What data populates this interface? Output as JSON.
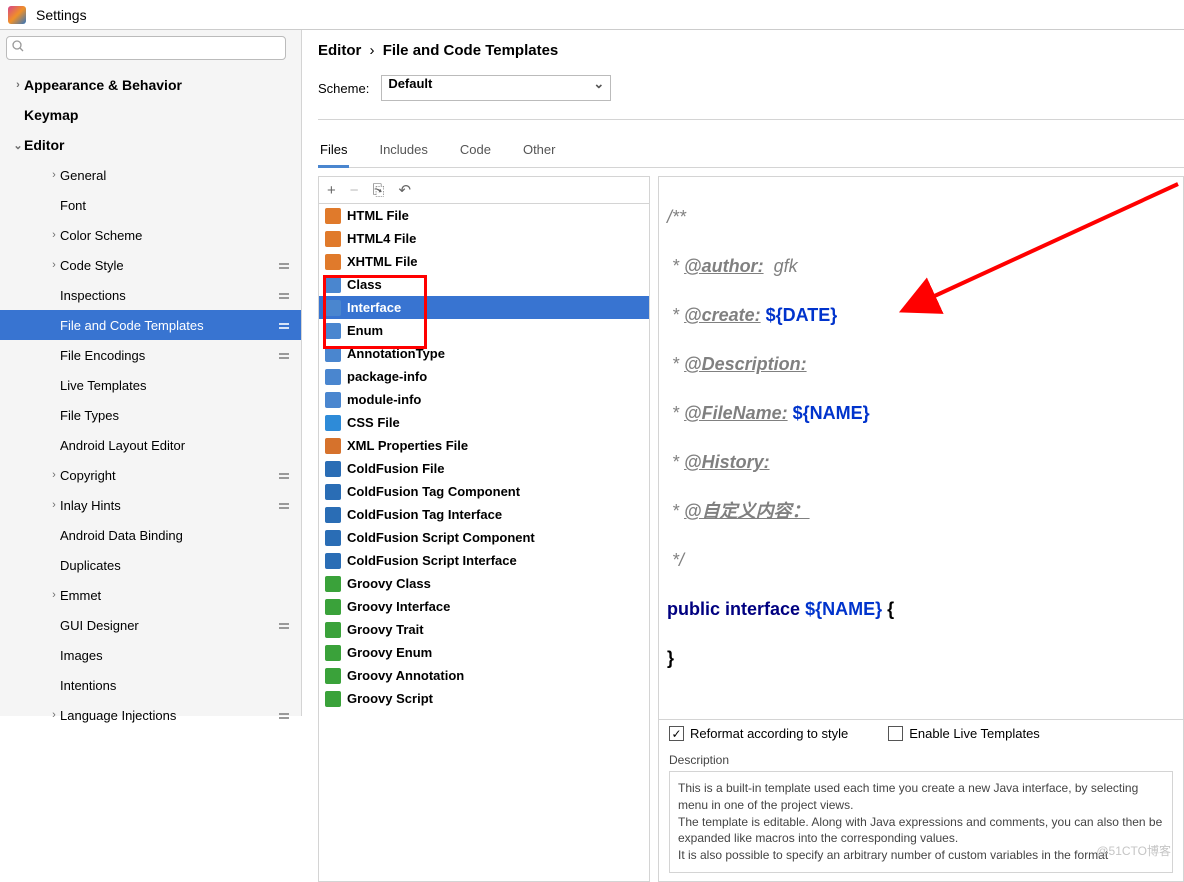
{
  "app": {
    "title": "Settings"
  },
  "search": {
    "placeholder": ""
  },
  "nav": {
    "items": [
      {
        "label": "Appearance & Behavior",
        "arrow": "›",
        "cls": "top"
      },
      {
        "label": "Keymap",
        "arrow": "",
        "cls": "top"
      },
      {
        "label": "Editor",
        "arrow": "⌄",
        "cls": "top"
      },
      {
        "label": "General",
        "arrow": "›",
        "cls": "lv2"
      },
      {
        "label": "Font",
        "arrow": "",
        "cls": "lv2"
      },
      {
        "label": "Color Scheme",
        "arrow": "›",
        "cls": "lv2"
      },
      {
        "label": "Code Style",
        "arrow": "›",
        "cls": "lv2",
        "gear": true
      },
      {
        "label": "Inspections",
        "arrow": "",
        "cls": "lv2",
        "gear": true
      },
      {
        "label": "File and Code Templates",
        "arrow": "",
        "cls": "lv2",
        "gear": true,
        "selected": true
      },
      {
        "label": "File Encodings",
        "arrow": "",
        "cls": "lv2",
        "gear": true
      },
      {
        "label": "Live Templates",
        "arrow": "",
        "cls": "lv2"
      },
      {
        "label": "File Types",
        "arrow": "",
        "cls": "lv2"
      },
      {
        "label": "Android Layout Editor",
        "arrow": "",
        "cls": "lv2"
      },
      {
        "label": "Copyright",
        "arrow": "›",
        "cls": "lv2",
        "gear": true
      },
      {
        "label": "Inlay Hints",
        "arrow": "›",
        "cls": "lv2",
        "gear": true
      },
      {
        "label": "Android Data Binding",
        "arrow": "",
        "cls": "lv2"
      },
      {
        "label": "Duplicates",
        "arrow": "",
        "cls": "lv2"
      },
      {
        "label": "Emmet",
        "arrow": "›",
        "cls": "lv2"
      },
      {
        "label": "GUI Designer",
        "arrow": "",
        "cls": "lv2",
        "gear": true
      },
      {
        "label": "Images",
        "arrow": "",
        "cls": "lv2"
      },
      {
        "label": "Intentions",
        "arrow": "",
        "cls": "lv2"
      },
      {
        "label": "Language Injections",
        "arrow": "›",
        "cls": "lv2",
        "gear": true
      }
    ]
  },
  "breadcrumb": {
    "a": "Editor",
    "b": "File and Code Templates"
  },
  "scheme": {
    "label": "Scheme:",
    "value": "Default"
  },
  "tabs": [
    "Files",
    "Includes",
    "Code",
    "Other"
  ],
  "toolbar": {
    "add": "+",
    "remove": "−",
    "copy": "⎘",
    "revert": "↶"
  },
  "files": [
    {
      "label": "HTML File",
      "color": "#e07a2b"
    },
    {
      "label": "HTML4 File",
      "color": "#e07a2b"
    },
    {
      "label": "XHTML File",
      "color": "#e07a2b"
    },
    {
      "label": "Class",
      "color": "#4a86cf"
    },
    {
      "label": "Interface",
      "color": "#4a86cf",
      "selected": true
    },
    {
      "label": "Enum",
      "color": "#4a86cf"
    },
    {
      "label": "AnnotationType",
      "color": "#4a86cf"
    },
    {
      "label": "package-info",
      "color": "#4a86cf"
    },
    {
      "label": "module-info",
      "color": "#4a86cf"
    },
    {
      "label": "CSS File",
      "color": "#2e8bd8"
    },
    {
      "label": "XML Properties File",
      "color": "#d6722c"
    },
    {
      "label": "ColdFusion File",
      "color": "#2a6db5"
    },
    {
      "label": "ColdFusion Tag Component",
      "color": "#2a6db5"
    },
    {
      "label": "ColdFusion Tag Interface",
      "color": "#2a6db5"
    },
    {
      "label": "ColdFusion Script Component",
      "color": "#2a6db5"
    },
    {
      "label": "ColdFusion Script Interface",
      "color": "#2a6db5"
    },
    {
      "label": "Groovy Class",
      "color": "#3aa23a"
    },
    {
      "label": "Groovy Interface",
      "color": "#3aa23a"
    },
    {
      "label": "Groovy Trait",
      "color": "#3aa23a"
    },
    {
      "label": "Groovy Enum",
      "color": "#3aa23a"
    },
    {
      "label": "Groovy Annotation",
      "color": "#3aa23a"
    },
    {
      "label": "Groovy Script",
      "color": "#3aa23a"
    }
  ],
  "code": {
    "l0": "/**",
    "l1_pre": " * ",
    "l1_tag": "@author:",
    "l1_rest": "  gfk",
    "l2_pre": " * ",
    "l2_tag": "@create:",
    "l2_rest": " ",
    "l2_var": "${DATE}",
    "l3_pre": " * ",
    "l3_tag": "@Description:",
    "l4_pre": " * ",
    "l4_tag": "@FileName:",
    "l4_rest": " ",
    "l4_var": "${NAME}",
    "l5_pre": " * ",
    "l5_tag": "@History:",
    "l6_pre": " * ",
    "l6_tag": "@自定义内容：",
    "l7": " */",
    "l8_kw1": "public",
    "l8_kw2": "interface",
    "l8_var": "${NAME}",
    "l8_brace": " {",
    "l9": "}"
  },
  "checks": {
    "reformat": "Reformat according to style",
    "liveTpl": "Enable Live Templates"
  },
  "desc": {
    "label": "Description",
    "p1": "This is a built-in template used each time you create a new Java interface, by selecting menu in one of the project views.",
    "p2": "The template is editable. Along with Java expressions and comments, you can also then be expanded like macros into the corresponding values.",
    "p3": "It is also possible to specify an arbitrary number of custom variables in the format"
  },
  "watermark": "@51CTO博客"
}
